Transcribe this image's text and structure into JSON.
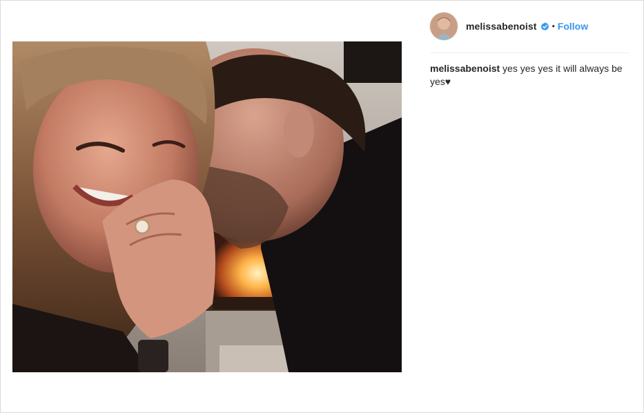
{
  "post": {
    "username": "melissabenoist",
    "separator": "•",
    "follow_label": "Follow",
    "caption_text": "yes yes yes it will always be yes♥",
    "verified_icon": "verified-badge-icon",
    "accent_color": "#3897f0"
  }
}
